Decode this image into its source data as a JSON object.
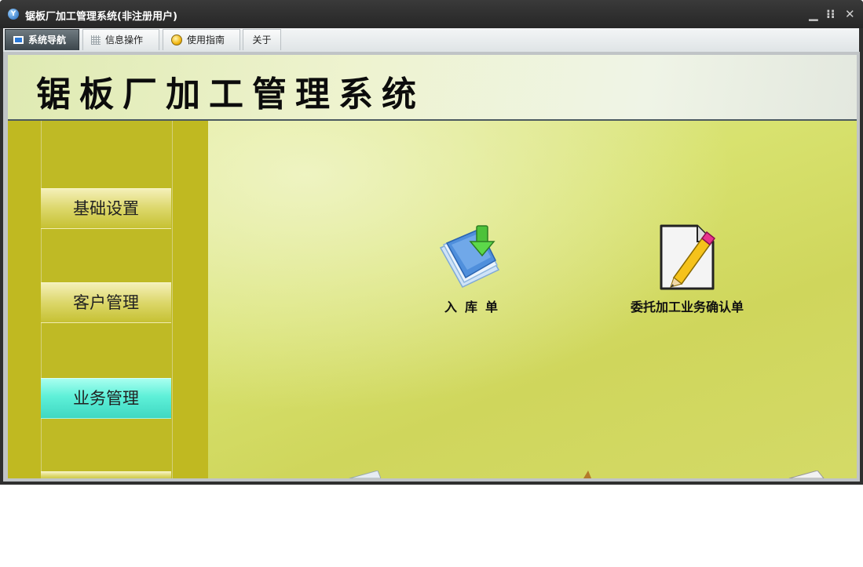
{
  "window": {
    "title": "锯板厂加工管理系统(非注册用户)",
    "app_icon_letter": "Y"
  },
  "controls": {
    "minimize": "▁",
    "restore": "⁝⁝",
    "close": "✕"
  },
  "menu_tabs": [
    {
      "label": "系统导航",
      "icon": "screen-icon",
      "active": true
    },
    {
      "label": "信息操作",
      "icon": "grid-icon",
      "active": false
    },
    {
      "label": "使用指南",
      "icon": "guide-icon",
      "active": false
    },
    {
      "label": "关于",
      "icon": "",
      "active": false
    }
  ],
  "header": {
    "system_title": "锯板厂加工管理系统"
  },
  "sidebar": {
    "items": [
      {
        "label": "基础设置",
        "active": false
      },
      {
        "label": "客户管理",
        "active": false
      },
      {
        "label": "业务管理",
        "active": true
      }
    ]
  },
  "main": {
    "cards": [
      {
        "label": "入库单",
        "icon": "document-download-icon"
      },
      {
        "label": "委托加工业务确认单",
        "icon": "document-edit-icon"
      }
    ]
  },
  "colors": {
    "titlebar": "#2f2f2f",
    "sidebar": "#c0b921",
    "active_item": "#5ef0d8",
    "main_bg": "#d8e26f"
  }
}
